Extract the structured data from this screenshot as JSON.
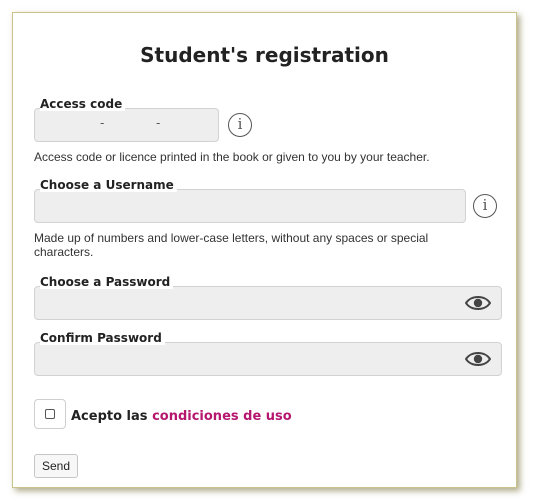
{
  "form": {
    "title": "Student's registration",
    "access_code": {
      "label": "Access code",
      "separators": [
        "-",
        "-"
      ],
      "help": "Access code or licence printed in the book or given to you by your teacher."
    },
    "username": {
      "label": "Choose a Username",
      "help_line1": "Made up of numbers and lower-case letters, without any spaces or special",
      "help_line2": "characters."
    },
    "password": {
      "label": "Choose a Password"
    },
    "confirm_password": {
      "label": "Confirm Password"
    },
    "terms": {
      "prefix": "Acepto las",
      "link": "condiciones de uso"
    },
    "send_label": "Send"
  },
  "icons": {
    "info": "info-circle-icon",
    "eye": "eye-icon"
  },
  "colors": {
    "link": "#b5176e",
    "field_bg": "#eeeeee",
    "card_border": "#c9c28a"
  }
}
